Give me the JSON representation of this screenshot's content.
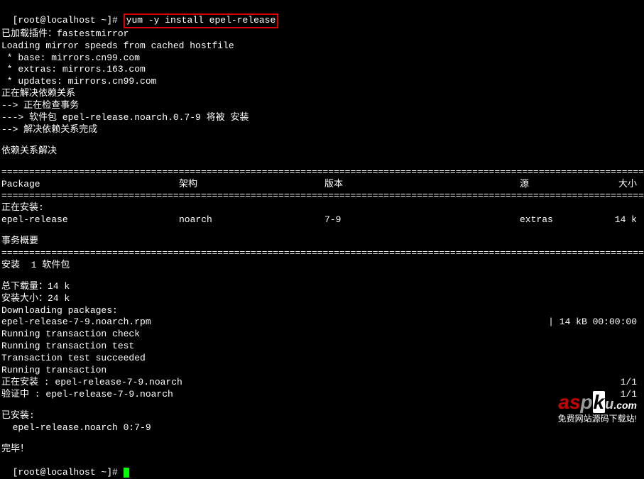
{
  "prompt": "[root@localhost ~]# ",
  "command": "yum -y install epel-release",
  "lines_pre": [
    "已加载插件：fastestmirror",
    "Loading mirror speeds from cached hostfile",
    " * base: mirrors.cn99.com",
    " * extras: mirrors.163.com",
    " * updates: mirrors.cn99.com",
    "正在解决依赖关系",
    "--> 正在检查事务",
    "---> 软件包 epel-release.noarch.0.7-9 将被 安装",
    "--> 解决依赖关系完成"
  ],
  "dep_resolved": "依赖关系解决",
  "sep_line": "========================================================================================================================",
  "dash_line": "------------------------------------------------------------------------------------------------------------------------",
  "headers": {
    "package": " Package",
    "arch": "架构",
    "version": "版本",
    "repo": "源",
    "size": "大小"
  },
  "installing_label": "正在安装:",
  "row": {
    "package": " epel-release",
    "arch": "noarch",
    "version": "7-9",
    "repo": "extras",
    "size": "14 k"
  },
  "summary_label": "事务概要",
  "install_count": "安装  1 软件包",
  "totals": [
    "总下载量：14 k",
    "安装大小：24 k",
    "Downloading packages:"
  ],
  "download": {
    "file": "epel-release-7-9.noarch.rpm",
    "progress": "|  14 kB  00:00:00"
  },
  "trans_lines": [
    "Running transaction check",
    "Running transaction test",
    "Transaction test succeeded",
    "Running transaction"
  ],
  "trans_install": {
    "label": "  正在安装    : epel-release-7-9.noarch",
    "count": "1/1"
  },
  "trans_verify": {
    "label": "  验证中      : epel-release-7-9.noarch",
    "count": "1/1"
  },
  "installed_label": "已安装:",
  "installed_pkg": "  epel-release.noarch 0:7-9",
  "complete": "完毕！",
  "prompt2": "[root@localhost ~]# ",
  "watermark": {
    "a": "a",
    "s": "s",
    "p": "p",
    "k": "k",
    "u": "u",
    "com": ".com",
    "tag": "免费网站源码下载站!"
  }
}
